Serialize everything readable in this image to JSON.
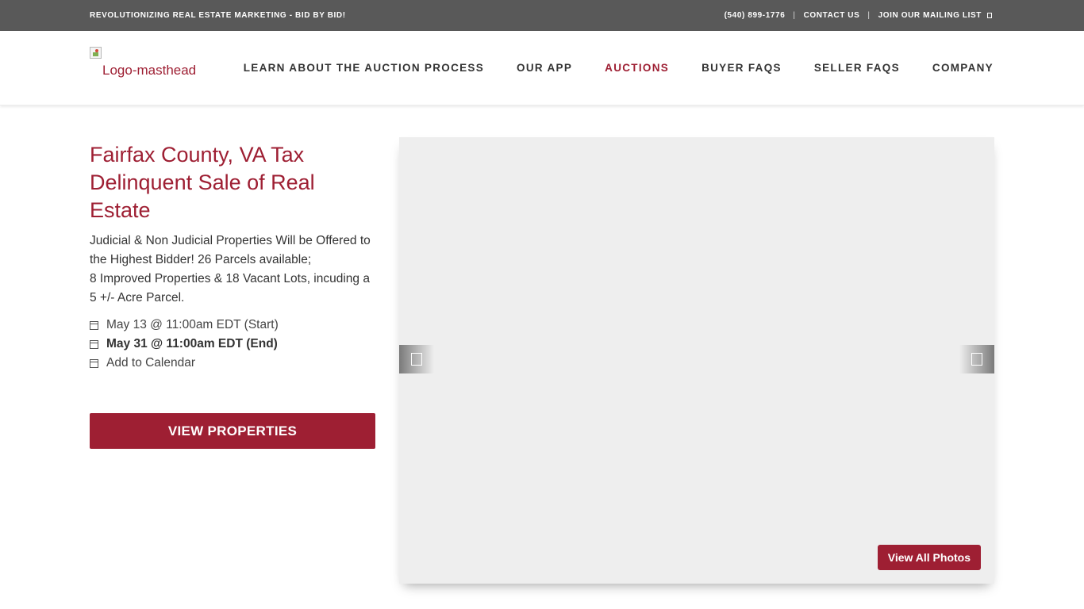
{
  "topbar": {
    "tagline": "REVOLUTIONIZING REAL ESTATE MARKETING - BID BY BID!",
    "phone": "(540) 899-1776",
    "separator": "|",
    "contact": "CONTACT US",
    "mailing_list": "JOIN OUR MAILING LIST"
  },
  "header": {
    "logo_alt": "Logo-masthead",
    "nav": [
      {
        "label": "LEARN ABOUT THE AUCTION PROCESS",
        "active": false
      },
      {
        "label": "OUR APP",
        "active": false
      },
      {
        "label": "AUCTIONS",
        "active": true
      },
      {
        "label": "BUYER FAQS",
        "active": false
      },
      {
        "label": "SELLER FAQS",
        "active": false
      },
      {
        "label": "COMPANY",
        "active": false
      }
    ]
  },
  "auction": {
    "title": "Fairfax County, VA Tax Delinquent Sale of Real Estate",
    "description_1": "Judicial & Non Judicial Properties Will be Offered to the Highest Bidder! 26 Parcels available;",
    "description_2": "8 Improved Properties & 18 Vacant Lots, incuding a 5 +/- Acre Parcel.",
    "start": "May 13 @ 11:00am EDT (Start)",
    "end": "May 31 @ 11:00am EDT (End)",
    "add_calendar": "Add to Calendar",
    "view_properties": "VIEW PROPERTIES"
  },
  "gallery": {
    "view_all_photos": "View All Photos"
  },
  "colors": {
    "accent": "#9e1f33",
    "topbar": "#595959",
    "gallery_bg": "#eeeeee"
  }
}
